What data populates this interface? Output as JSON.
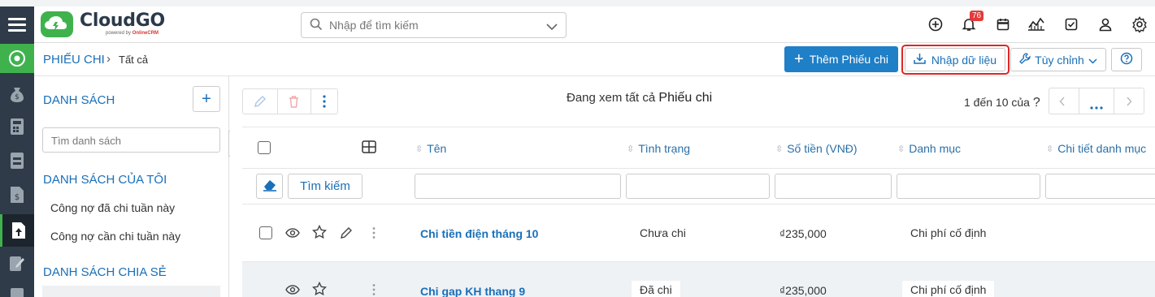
{
  "app": {
    "brand": "CloudGO",
    "powered_by": "powered by",
    "powered_brand": "OnlineCRM",
    "search_placeholder": "Nhập để tìm kiếm",
    "notification_count": "76"
  },
  "breadcrumb": {
    "module": "PHIẾU CHI",
    "separator": "›",
    "view": "Tất cả"
  },
  "actions": {
    "add_label": "Thêm Phiếu chi",
    "import_label": "Nhập dữ liệu",
    "customize_label": "Tùy chỉnh"
  },
  "sidebar": {
    "title": "DANH SÁCH",
    "search_placeholder": "Tìm danh sách",
    "my_lists_title": "DANH SÁCH CỦA TÔI",
    "my_lists": [
      "Công nợ đã chi tuần này",
      "Công nợ cần chi tuần này"
    ],
    "shared_title": "DANH SÁCH CHIA SẺ"
  },
  "listview": {
    "viewing_prefix": "Đang xem tất cả",
    "viewing_module": "Phiếu chi",
    "paging_text": "1 đến 10 của",
    "paging_unknown": "?",
    "search_button": "Tìm kiếm",
    "columns": [
      "Tên",
      "Tình trạng",
      "Số tiền (VNĐ)",
      "Danh mục",
      "Chi tiết danh mục"
    ],
    "rows": [
      {
        "name": "Chi tiền điện tháng 10",
        "status": "Chưa chi",
        "amount": "₫235,000",
        "category": "Chi phí cố định"
      },
      {
        "name": "Chi gap KH thang 9",
        "status": "Đã chi",
        "amount": "₫235,000",
        "category": "Chi phí cố định"
      }
    ]
  },
  "colors": {
    "brand_green": "#3fb24e",
    "primary_blue": "#1f7fc7",
    "rail_dark": "#2f3b48",
    "highlight_red": "#e02626"
  }
}
